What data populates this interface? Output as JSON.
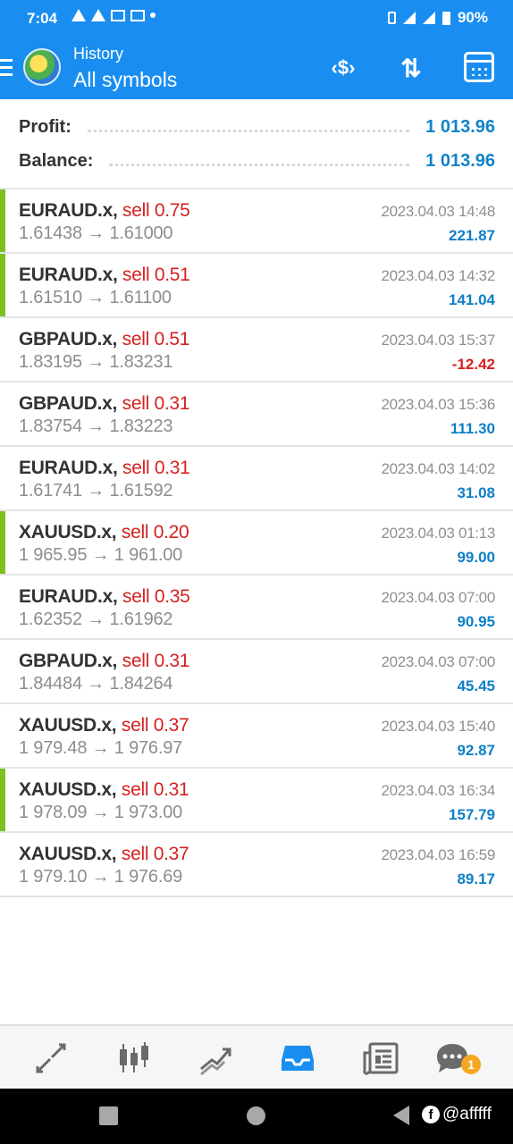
{
  "status_bar": {
    "time": "7:04",
    "battery": "90%"
  },
  "header": {
    "subtitle": "History",
    "title": "All symbols"
  },
  "summary": {
    "profit_label": "Profit:",
    "profit_value": "1 013.96",
    "balance_label": "Balance:",
    "balance_value": "1 013.96"
  },
  "trades": [
    {
      "symbol": "EURAUD.x,",
      "side": "sell 0.75",
      "open": "1.61438",
      "close": "1.61000",
      "time": "2023.04.03 14:48",
      "profit": "221.87",
      "win": true
    },
    {
      "symbol": "EURAUD.x,",
      "side": "sell 0.51",
      "open": "1.61510",
      "close": "1.61100",
      "time": "2023.04.03 14:32",
      "profit": "141.04",
      "win": true
    },
    {
      "symbol": "GBPAUD.x,",
      "side": "sell 0.51",
      "open": "1.83195",
      "close": "1.83231",
      "time": "2023.04.03 15:37",
      "profit": "-12.42",
      "win": false
    },
    {
      "symbol": "GBPAUD.x,",
      "side": "sell 0.31",
      "open": "1.83754",
      "close": "1.83223",
      "time": "2023.04.03 15:36",
      "profit": "111.30",
      "win": false
    },
    {
      "symbol": "EURAUD.x,",
      "side": "sell 0.31",
      "open": "1.61741",
      "close": "1.61592",
      "time": "2023.04.03 14:02",
      "profit": "31.08",
      "win": false
    },
    {
      "symbol": "XAUUSD.x,",
      "side": "sell 0.20",
      "open": "1 965.95",
      "close": "1 961.00",
      "time": "2023.04.03 01:13",
      "profit": "99.00",
      "win": true
    },
    {
      "symbol": "EURAUD.x,",
      "side": "sell 0.35",
      "open": "1.62352",
      "close": "1.61962",
      "time": "2023.04.03 07:00",
      "profit": "90.95",
      "win": false
    },
    {
      "symbol": "GBPAUD.x,",
      "side": "sell 0.31",
      "open": "1.84484",
      "close": "1.84264",
      "time": "2023.04.03 07:00",
      "profit": "45.45",
      "win": false
    },
    {
      "symbol": "XAUUSD.x,",
      "side": "sell 0.37",
      "open": "1 979.48",
      "close": "1 976.97",
      "time": "2023.04.03 15:40",
      "profit": "92.87",
      "win": false
    },
    {
      "symbol": "XAUUSD.x,",
      "side": "sell 0.31",
      "open": "1 978.09",
      "close": "1 973.00",
      "time": "2023.04.03 16:34",
      "profit": "157.79",
      "win": true
    },
    {
      "symbol": "XAUUSD.x,",
      "side": "sell 0.37",
      "open": "1 979.10",
      "close": "1 976.69",
      "time": "2023.04.03 16:59",
      "profit": "89.17",
      "win": false
    }
  ],
  "arrow": "→",
  "bottom_nav": {
    "items": [
      "quotes-icon",
      "chart-icon",
      "trade-icon",
      "history-icon",
      "news-icon",
      "chat-icon"
    ],
    "active": "history-icon",
    "chat_badge": "1"
  },
  "watermark": "@afffff",
  "colors": {
    "accent": "#1a8ef0",
    "profit": "#0e7fc7",
    "loss": "#d62020",
    "win_bar": "#7cc022"
  }
}
